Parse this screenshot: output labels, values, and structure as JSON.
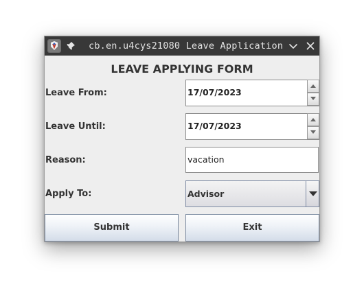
{
  "window": {
    "title": "cb.en.u4cys21080 Leave Application"
  },
  "form": {
    "heading": "LEAVE APPLYING FORM",
    "leave_from": {
      "label": "Leave From:",
      "value": "17/07/2023"
    },
    "leave_until": {
      "label": "Leave Until:",
      "value": "17/07/2023"
    },
    "reason": {
      "label": "Reason:",
      "value": "vacation"
    },
    "apply_to": {
      "label": "Apply To:",
      "selected": "Advisor"
    }
  },
  "buttons": {
    "submit": "Submit",
    "exit": "Exit"
  },
  "icons": {
    "app": "java-app-icon",
    "pin": "pin-icon",
    "minimize": "chevron-down-icon",
    "close": "close-icon",
    "spin_up": "arrow-up-icon",
    "spin_down": "arrow-down-icon",
    "dropdown": "caret-down-icon"
  },
  "colors": {
    "titlebar": "#383838",
    "window_bg": "#eeeeee",
    "field_border": "#8a8a8a",
    "button_border": "#7a8aa0"
  }
}
